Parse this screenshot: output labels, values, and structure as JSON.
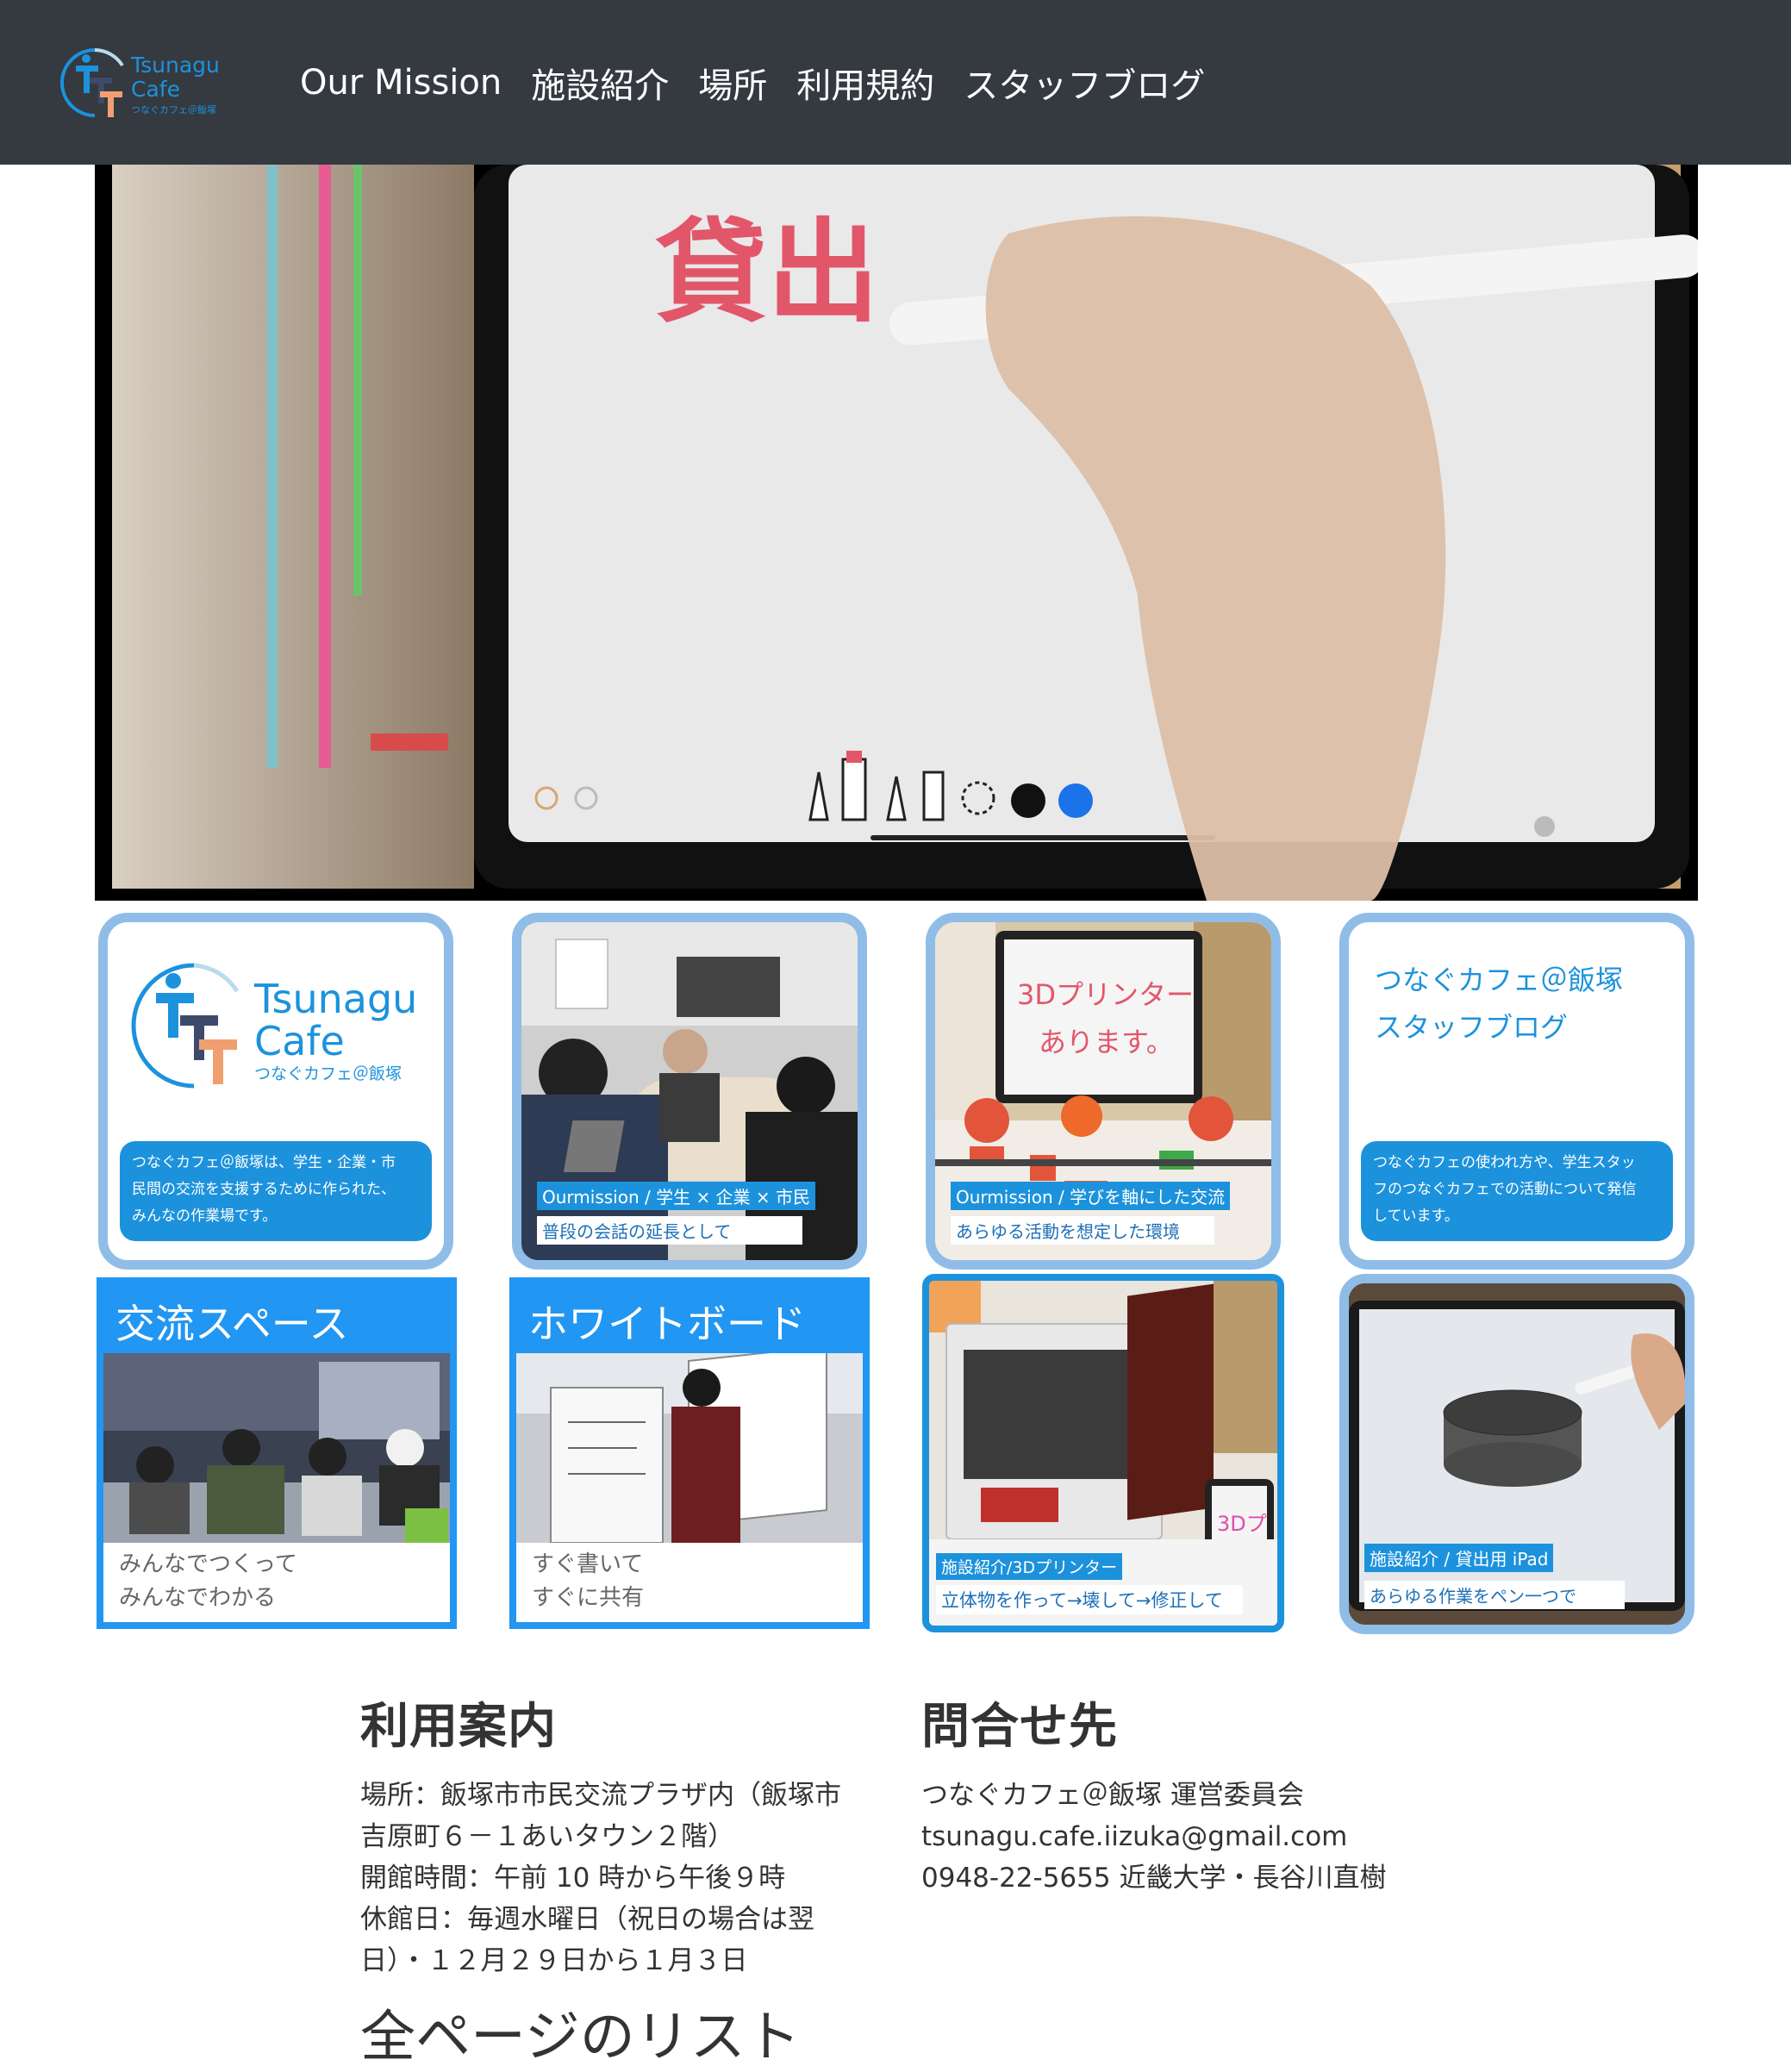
{
  "nav": {
    "logo_text_1": "Tsunagu",
    "logo_text_2": "Cafe",
    "logo_text_3": "つなぐカフェ＠飯塚",
    "links": [
      {
        "label": "Our Mission"
      },
      {
        "label": "施設紹介"
      },
      {
        "label": "場所"
      },
      {
        "label": "利用規約"
      },
      {
        "label": "スタッフブログ"
      }
    ]
  },
  "hero": {
    "whiteboard_text": "貸出"
  },
  "cards": {
    "logo_card": {
      "logo_text_1": "Tsunagu",
      "logo_text_2": "Cafe",
      "logo_text_3": "つなぐカフェ＠飯塚",
      "desc_line1": "つなぐカフェ＠飯塚は、学生・企業・市",
      "desc_line2": "民間の交流を支援するために作られた、",
      "desc_line3": "みんなの作業場です。"
    },
    "mission_card": {
      "caption": "Ourmission / 学生 × 企業 × 市民",
      "subcaption": "普段の会話の延長として"
    },
    "printer_tablet_card": {
      "board_line1": "3Dプリンター",
      "board_line2": "あります。",
      "caption": "Ourmission / 学びを軸にした交流",
      "subcaption": "あらゆる活動を想定した環境"
    },
    "blog_card": {
      "title_line1": "つなぐカフェ＠飯塚",
      "title_line2": "スタッフブログ",
      "desc_line1": "つなぐカフェの使われ方や、学生スタッ",
      "desc_line2": "フのつなぐカフェでの活動について発信",
      "desc_line3": "しています。"
    },
    "exchange_card": {
      "title": "交流スペース",
      "line1": "みんなでつくって",
      "line2": "みんなでわかる"
    },
    "whiteboard_card": {
      "title": "ホワイトボード",
      "line1": "すぐ書いて",
      "line2": "すぐに共有"
    },
    "printer_card": {
      "tablet_text": "3Dプ",
      "caption": "施設紹介/3Dプリンター",
      "subcaption": "立体物を作って→壊して→修正して"
    },
    "ipad_card": {
      "caption": "施設紹介 / 貸出用 iPad",
      "subcaption": "あらゆる作業をペン一つで"
    }
  },
  "info": {
    "usage": {
      "heading": "利用案内",
      "lines": [
        "場所：飯塚市市民交流プラザ内（飯塚市",
        "吉原町６－１あいタウン２階）",
        "開館時間：午前 10 時から午後９時",
        "休館日：毎週水曜日（祝日の場合は翌",
        "日）・１２月２９日から１月３日"
      ]
    },
    "contact": {
      "heading": "問合せ先",
      "lines": [
        "つなぐカフェ＠飯塚 運営委員会",
        "tsunagu.cafe.iizuka@gmail.com",
        "0948-22-5655 近畿大学・長谷川直樹"
      ]
    },
    "all_pages": "全ページのリスト"
  },
  "colors": {
    "navbar": "#343a40",
    "accent_blue": "#1d92dc",
    "card_border": "#8fbde8",
    "square_border": "#2196f3"
  }
}
